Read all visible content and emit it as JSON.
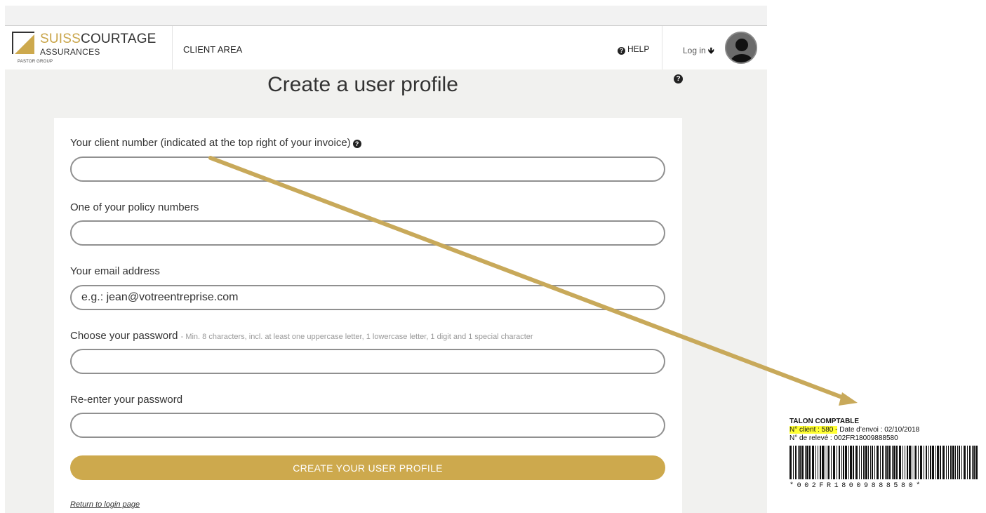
{
  "header": {
    "logo": {
      "brand_part1": "SUISS",
      "brand_part2": "COURTAGE",
      "sub": "ASSURANCES",
      "group": "PASTOR GROUP"
    },
    "nav_client_area": "CLIENT AREA",
    "help_label": "HELP",
    "login_label": "Log in",
    "login_arrow": "🡻"
  },
  "page": {
    "title": "Create a user profile",
    "help_icon": "?"
  },
  "form": {
    "client_number_label": "Your client number (indicated at the top right of your invoice)",
    "client_number_help": "?",
    "client_number_value": "",
    "policy_label": "One of your policy numbers",
    "policy_value": "",
    "email_label": "Your email address",
    "email_placeholder": "e.g.: jean@votreentreprise.com",
    "password_label": "Choose your password",
    "password_hint": "- Min. 8 characters, incl. at least one uppercase letter, 1 lowercase letter, 1 digit and 1 special character",
    "password_value": "",
    "password2_label": "Re-enter your password",
    "password2_value": "",
    "submit_label": "CREATE YOUR USER PROFILE",
    "return_link": "Return to login page"
  },
  "annotation": {
    "arrow_color": "#c8a95a"
  },
  "slip": {
    "title": "TALON COMPTABLE",
    "client_highlight": "N° client : 580 -",
    "client_rest": " Date d’envoi : 02/10/2018",
    "statement": "N° de relevé : 002FR18009888580",
    "barcode_text": "*002FR18009888580*"
  },
  "colors": {
    "accent": "#cda94d",
    "highlight": "#ffff33",
    "panel_bg": "#f1f1ef"
  }
}
